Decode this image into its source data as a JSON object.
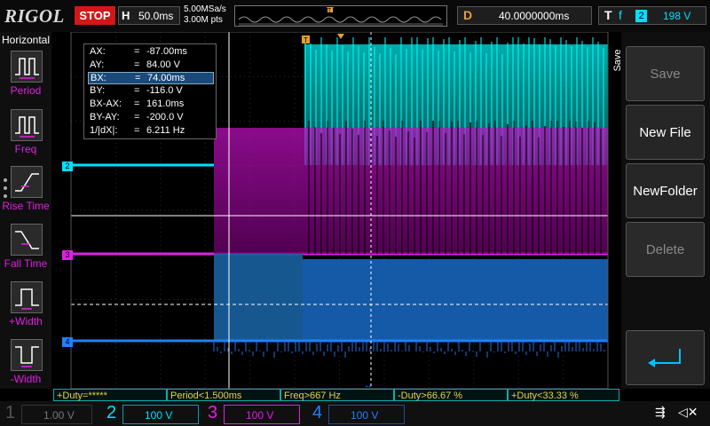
{
  "top": {
    "logo": "RIGOL",
    "run_state": "STOP",
    "h_label": "H",
    "timebase": "50.0ms",
    "sample_rate": "5.00MSa/s",
    "mem_depth": "3.00M pts",
    "d_label": "D",
    "delay": "40.0000000ms",
    "t_label": "T",
    "trigger_edge": "f",
    "trigger_source": "2",
    "trigger_level": "198 V"
  },
  "left": {
    "title": "Horizontal",
    "items": [
      {
        "label": "Period",
        "icon": "period-icon"
      },
      {
        "label": "Freq",
        "icon": "freq-icon"
      },
      {
        "label": "Rise Time",
        "icon": "rise-time-icon"
      },
      {
        "label": "Fall Time",
        "icon": "fall-time-icon"
      },
      {
        "label": "+Width",
        "icon": "pos-width-icon"
      },
      {
        "label": "-Width",
        "icon": "neg-width-icon"
      }
    ]
  },
  "cursor": {
    "rows": [
      {
        "name": "AX:",
        "eq": "=",
        "value": "-87.00ms"
      },
      {
        "name": "AY:",
        "eq": "=",
        "value": "84.00 V"
      },
      {
        "name": "BX:",
        "eq": "=",
        "value": "74.00ms"
      },
      {
        "name": "BY:",
        "eq": "=",
        "value": "-116.0 V"
      },
      {
        "name": "BX-AX:",
        "eq": "=",
        "value": "161.0ms"
      },
      {
        "name": "BY-AY:",
        "eq": "=",
        "value": "-200.0 V"
      },
      {
        "name": "1/|dX|:",
        "eq": "=",
        "value": "6.211 Hz"
      }
    ]
  },
  "right": {
    "tab": "Save",
    "buttons": [
      {
        "label": "Save",
        "enabled": false
      },
      {
        "label": "New File",
        "enabled": true
      },
      {
        "label": "NewFolder",
        "enabled": true
      },
      {
        "label": "Delete",
        "enabled": false
      },
      {
        "label": "",
        "enabled": true,
        "icon": "return-icon"
      }
    ]
  },
  "measurements": [
    "+Duty=*****",
    "Period<1.500ms",
    "Freq>667 Hz",
    "-Duty>66.67 %",
    "+Duty<33.33 %"
  ],
  "channels": [
    {
      "num": "1",
      "scale": "1.00 V",
      "color": "#d8d000",
      "active": false
    },
    {
      "num": "2",
      "scale": "100 V",
      "color": "#00e0ff",
      "active": true
    },
    {
      "num": "3",
      "scale": "100 V",
      "color": "#e020e0",
      "active": true
    },
    {
      "num": "4",
      "scale": "100 V",
      "color": "#2080ff",
      "active": true
    }
  ],
  "ch_markers": [
    "2",
    "3",
    "4"
  ],
  "colors": {
    "ch1": "#d8d000",
    "ch2": "#00e0ff",
    "ch3": "#e020e0",
    "ch4": "#2080ff",
    "accent": "#e9a030"
  }
}
